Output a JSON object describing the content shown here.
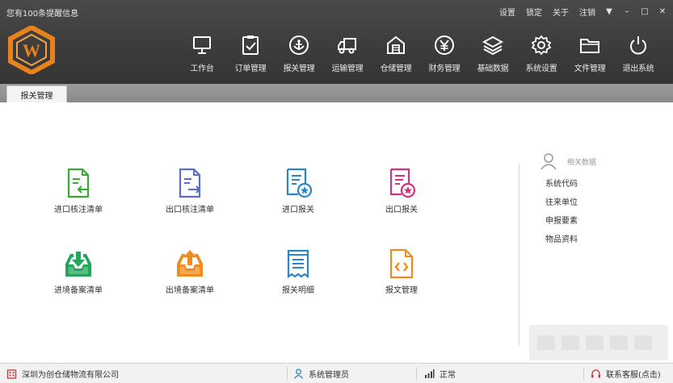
{
  "header": {
    "notice": "您有100条提醒信息",
    "top_links": {
      "settings": "设置",
      "lock": "锁定",
      "about": "关于",
      "logout": "注销"
    },
    "window_buttons": {
      "menu": "▼",
      "minimize": "–",
      "maximize": "□",
      "close": "✕"
    },
    "logo_letter": "W",
    "nav": [
      {
        "label": "工作台",
        "icon": "monitor-icon"
      },
      {
        "label": "订单管理",
        "icon": "clipboard-check-icon"
      },
      {
        "label": "报关管理",
        "icon": "anchor-icon"
      },
      {
        "label": "运输管理",
        "icon": "truck-icon"
      },
      {
        "label": "仓储管理",
        "icon": "warehouse-icon"
      },
      {
        "label": "财务管理",
        "icon": "yen-icon"
      },
      {
        "label": "基础数据",
        "icon": "layers-icon"
      },
      {
        "label": "系统设置",
        "icon": "gear-icon"
      },
      {
        "label": "文件管理",
        "icon": "folder-icon"
      },
      {
        "label": "退出系统",
        "icon": "power-icon"
      }
    ]
  },
  "tabs": {
    "active": "报关管理"
  },
  "functions": [
    {
      "label": "进口核注清单",
      "icon": "import-doc-icon",
      "color": "#3aaa35"
    },
    {
      "label": "出口核注清单",
      "icon": "export-doc-icon",
      "color": "#5b6fc6"
    },
    {
      "label": "进口报关",
      "icon": "import-declare-icon",
      "color": "#2a86c8"
    },
    {
      "label": "出口报关",
      "icon": "export-declare-icon",
      "color": "#d4317e"
    },
    {
      "label": "进境备案清单",
      "icon": "inbox-download-icon",
      "color": "#23a55a"
    },
    {
      "label": "出境备案清单",
      "icon": "inbox-upload-icon",
      "color": "#f08c1e"
    },
    {
      "label": "报关明细",
      "icon": "receipt-list-icon",
      "color": "#2a86c8"
    },
    {
      "label": "报文管理",
      "icon": "code-doc-icon",
      "color": "#f08c1e"
    }
  ],
  "related": {
    "title": "相关数据",
    "items": [
      "系统代码",
      "往来单位",
      "申报要素",
      "物品资料"
    ]
  },
  "status": {
    "company": "深圳为创仓储物流有限公司",
    "user": "系统管理员",
    "connection": "正常",
    "contact": "联系客服(点击)"
  },
  "colors": {
    "header_bg": "#3b3b3b",
    "logo_orange": "#e8821c",
    "tab_strip": "#8f8f8f"
  }
}
